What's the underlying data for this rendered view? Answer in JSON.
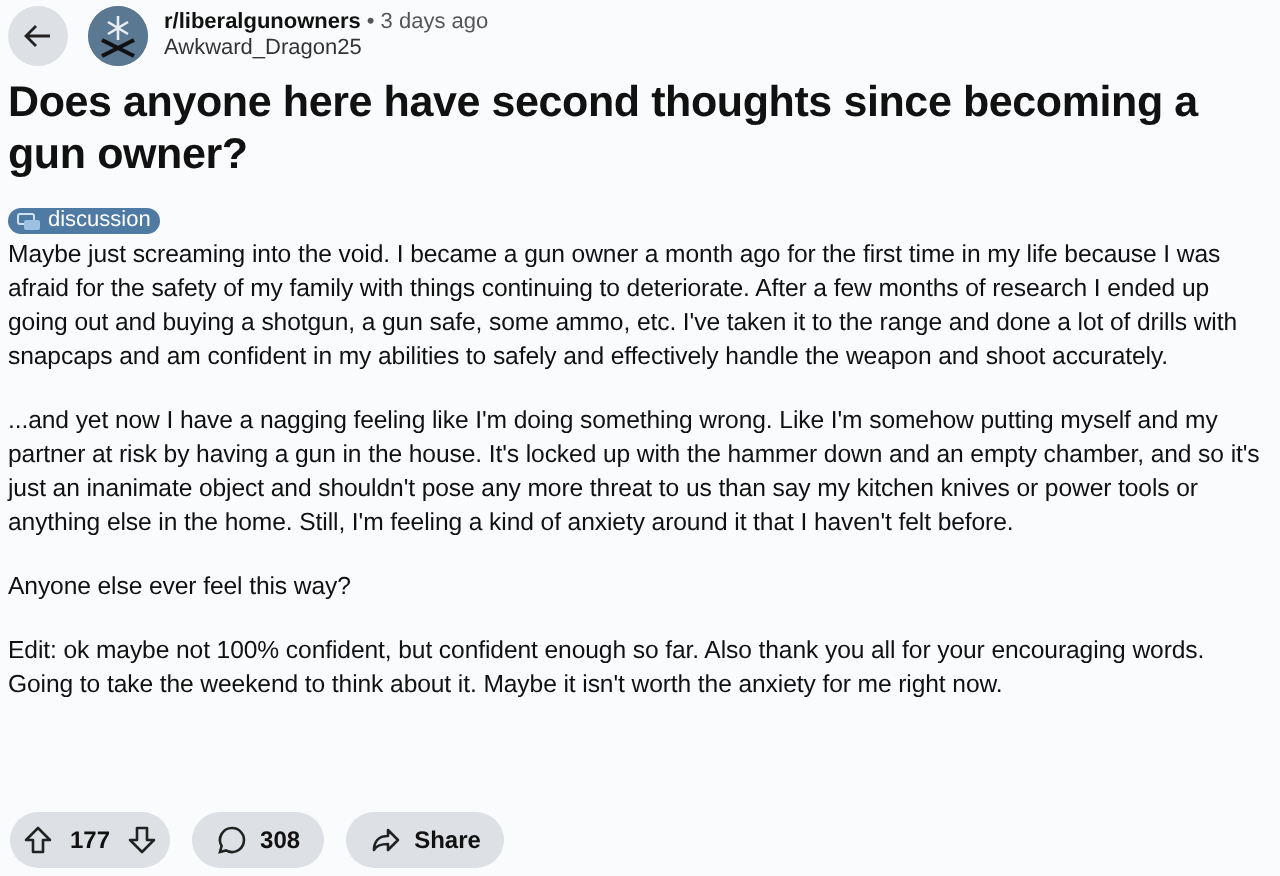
{
  "header": {
    "community": "r/liberalgunowners",
    "separator": "•",
    "time": "3 days ago",
    "author": "Awkward_Dragon25"
  },
  "title": "Does anyone here have second thoughts since becoming a gun owner?",
  "flair": "discussion",
  "paragraphs": [
    "Maybe just screaming into the void. I became a gun owner a month ago for the first time in my life because I was afraid for the safety of my family with things continuing to deteriorate. After a few months of research I ended up going out and buying a shotgun, a gun safe, some ammo, etc. I've taken it to the range and done a lot of drills with snapcaps and am confident in my abilities to safely and effectively handle the weapon and shoot accurately.",
    "...and yet now I have a nagging feeling like I'm doing something wrong. Like I'm somehow putting myself and my partner at risk by having a gun in the house. It's locked up with the hammer down and an empty chamber, and so it's just an inanimate object and shouldn't pose any more threat to us than say my kitchen knives or power tools or anything else in the home. Still, I'm feeling a kind of anxiety around it that I haven't felt before.",
    "Anyone else ever feel this way?",
    "Edit: ok maybe not 100% confident, but confident enough so far. Also thank you all for your encouraging words. Going to take the weekend to think about it. Maybe it isn't worth the anxiety for me right now."
  ],
  "actions": {
    "votes": "177",
    "comments": "308",
    "share": "Share"
  }
}
